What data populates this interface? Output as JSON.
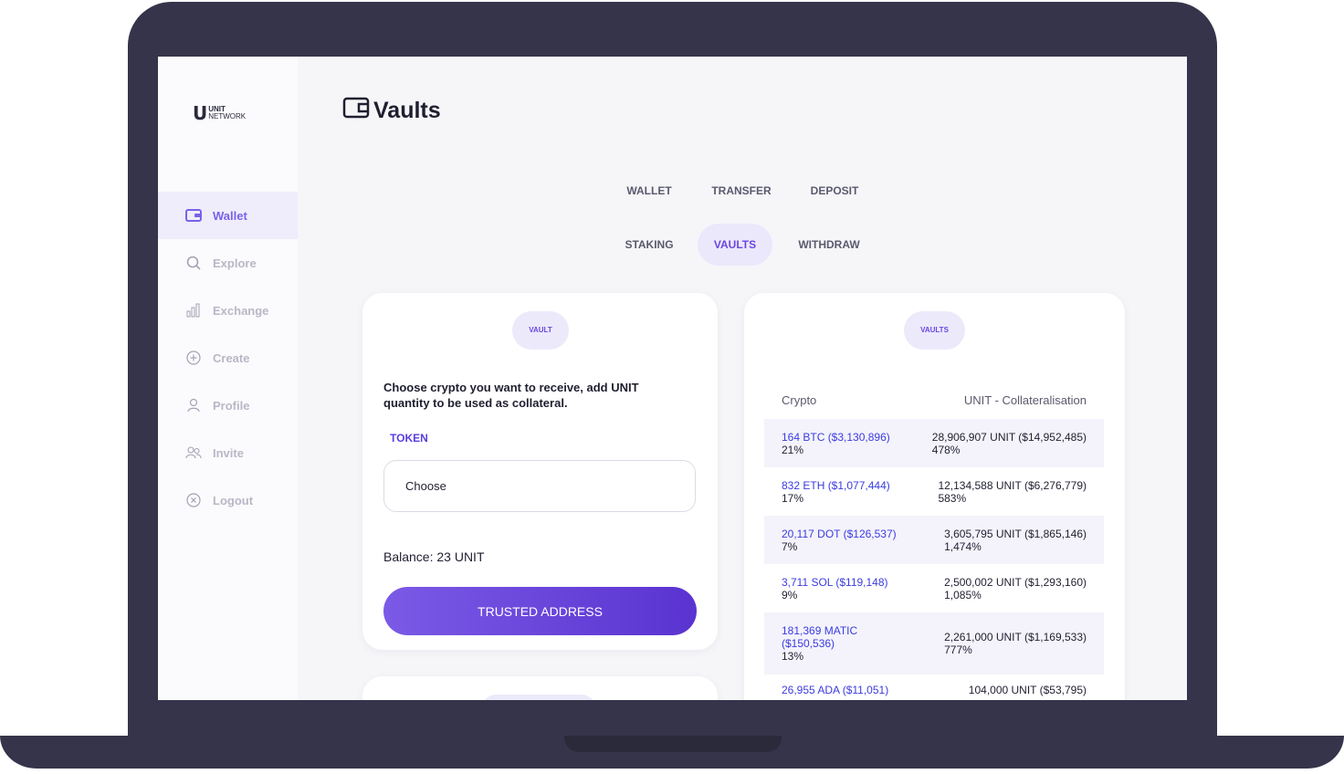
{
  "brand": {
    "line1": "UNIT",
    "line2": "NETWORK"
  },
  "sidebar": {
    "items": [
      {
        "label": "Wallet",
        "icon": "wallet-icon"
      },
      {
        "label": "Explore",
        "icon": "search-icon"
      },
      {
        "label": "Exchange",
        "icon": "chart-icon"
      },
      {
        "label": "Create",
        "icon": "plus-circle-icon"
      },
      {
        "label": "Profile",
        "icon": "user-icon"
      },
      {
        "label": "Invite",
        "icon": "users-icon"
      },
      {
        "label": "Logout",
        "icon": "close-circle-icon"
      }
    ],
    "active": "Wallet"
  },
  "page": {
    "title": "Vaults"
  },
  "tabs": {
    "row1": [
      "WALLET",
      "TRANSFER",
      "DEPOSIT"
    ],
    "row2": [
      "STAKING",
      "VAULTS",
      "WITHDRAW"
    ],
    "active": "VAULTS"
  },
  "vault_card": {
    "pill": "VAULT",
    "instruction": "Choose crypto you want to receive, add UNIT quantity to be used as collateral.",
    "token_label": "TOKEN",
    "select_placeholder": "Choose",
    "balance": "Balance: 23 UNIT",
    "button": "TRUSTED ADDRESS"
  },
  "vaults_card": {
    "pill": "VAULTS",
    "header_left": "Crypto",
    "header_right": "UNIT - Collateralisation",
    "rows": [
      {
        "crypto": "164 BTC ($3,130,896)",
        "pct": "21%",
        "unit": "28,906,907 UNIT ($14,952,485)",
        "ratio": "478%"
      },
      {
        "crypto": "832 ETH ($1,077,444)",
        "pct": "17%",
        "unit": "12,134,588 UNIT ($6,276,779)",
        "ratio": "583%"
      },
      {
        "crypto": "20,117 DOT ($126,537)",
        "pct": "7%",
        "unit": "3,605,795 UNIT ($1,865,146)",
        "ratio": "1,474%"
      },
      {
        "crypto": "3,711 SOL ($119,148)",
        "pct": "9%",
        "unit": "2,500,002 UNIT ($1,293,160)",
        "ratio": "1,085%"
      },
      {
        "crypto": "181,369 MATIC ($150,536)",
        "pct": "13%",
        "unit": "2,261,000 UNIT ($1,169,533)",
        "ratio": "777%"
      },
      {
        "crypto": "26,955 ADA ($11,051)",
        "pct": "",
        "unit": "104,000 UNIT ($53,795)",
        "ratio": ""
      }
    ]
  }
}
